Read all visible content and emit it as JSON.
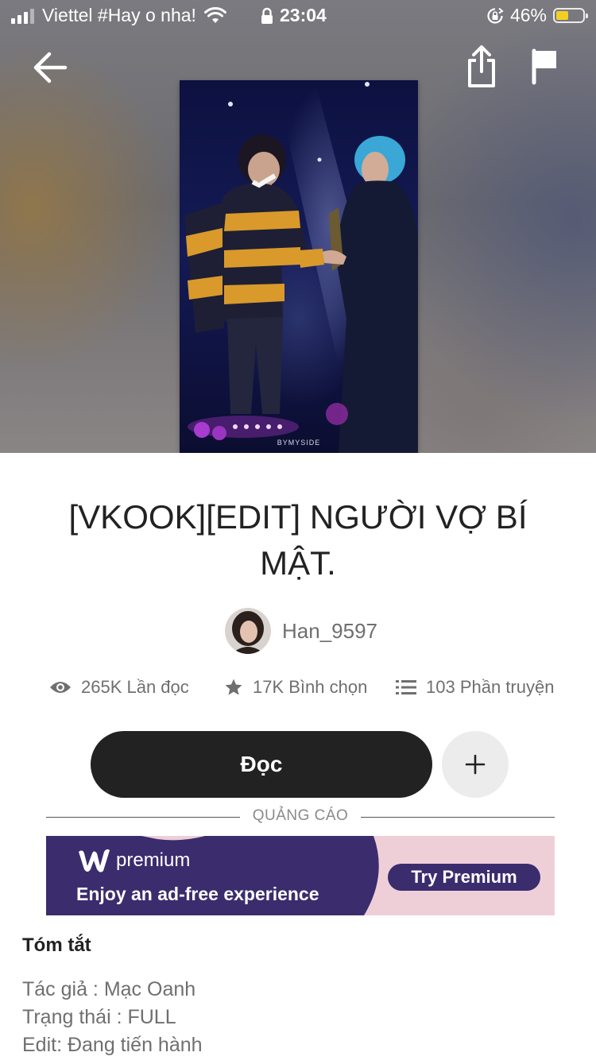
{
  "status_bar": {
    "carrier": "Viettel #Hay o nha!",
    "time": "23:04",
    "battery_percent": "46%",
    "battery_level": 0.46,
    "battery_color": "#f2d023"
  },
  "nav": {
    "back_icon": "arrow-left-icon",
    "share_icon": "share-icon",
    "report_icon": "flag-icon"
  },
  "cover": {
    "watermark": "BYMYSIDE"
  },
  "story": {
    "title": "[VKOOK][EDIT] NGƯỜI VỢ BÍ MẬT.",
    "author": "Han_9597"
  },
  "stats": {
    "reads": "265K Lần đọc",
    "votes": "17K Bình chọn",
    "parts": "103 Phần truyện"
  },
  "actions": {
    "read_label": "Đọc",
    "add_icon": "plus-icon"
  },
  "ad": {
    "divider_label": "QUẢNG CÁO",
    "brand": "premium",
    "tagline": "Enjoy an ad-free experience",
    "cta": "Try Premium",
    "colors": {
      "navy": "#3b2c6e",
      "pink": "#eecfd8"
    }
  },
  "summary": {
    "heading": "Tóm tắt",
    "lines": [
      "Tác giả : Mạc Oanh",
      "Trạng thái : FULL",
      "Edit: Đang tiến hành"
    ]
  }
}
